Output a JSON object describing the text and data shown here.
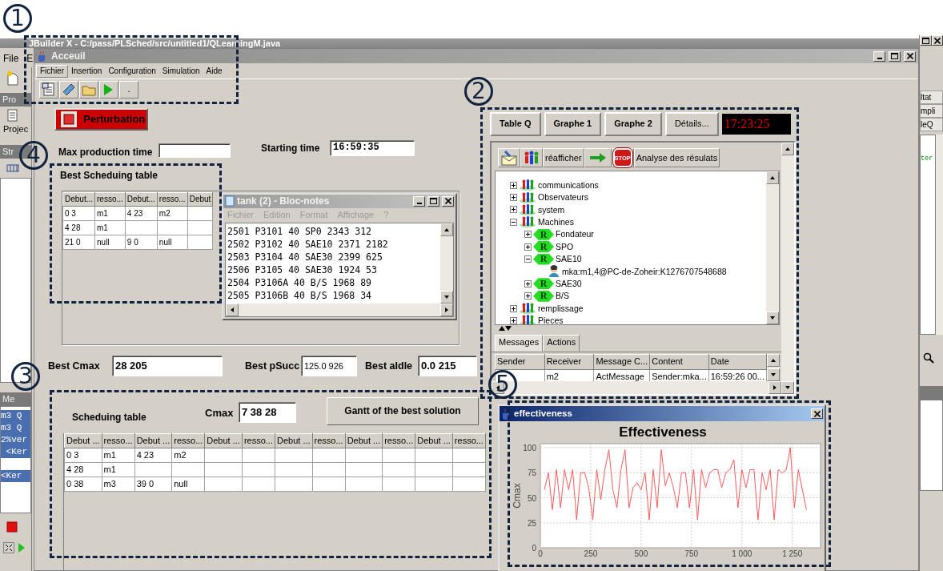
{
  "ide": {
    "title": "JBuilder X - C:/pass/PLSched/src/untitled1/QLearningM.java",
    "menu": [
      "File",
      "E"
    ],
    "left_headers": [
      "Pro",
      "Str",
      "Me"
    ],
    "project_label": "Projec",
    "code_lines": [
      "m3 Q",
      "m3 Q",
      "2%ver",
      " <Ker"
    ],
    "code_lines_lower": [
      "<Ker"
    ],
    "right_tabs": [
      "ltat",
      "mpli",
      "leQ"
    ],
    "right_code": "ter"
  },
  "window": {
    "title": "Acceuil",
    "menu": [
      {
        "label": "Fichier",
        "selected": true
      },
      {
        "label": "Insertion",
        "selected": false
      },
      {
        "label": "Configuration",
        "selected": false
      },
      {
        "label": "Simulation",
        "selected": false
      },
      {
        "label": "Aide",
        "selected": false
      }
    ],
    "toolbar_more": "."
  },
  "perturbation_button": "Perturbation",
  "max_production_time": {
    "label": "Max production time"
  },
  "starting_time": {
    "label": "Starting time",
    "value": "16:59:35"
  },
  "best_table": {
    "title": "Best Scheduing table",
    "columns": [
      "Debut...",
      "resso...",
      "Debut...",
      "resso...",
      "Debut"
    ],
    "rows": [
      [
        "0 3",
        "m1",
        "4 23",
        "m2",
        null
      ],
      [
        "4 28",
        "m1",
        null,
        null,
        null
      ],
      [
        "21 0",
        "null",
        "9 0",
        "null",
        null
      ]
    ]
  },
  "notepad": {
    "title": "tank (2) - Bloc-notes",
    "menu": [
      "Fichier",
      "Edition",
      "Format",
      "Affichage",
      "?"
    ],
    "lines": [
      "2501 P3101 40 SP0 2343 312",
      "2502 P3102 40 SAE10 2371 2182",
      "2503 P3104 40 SAE30 2399 625",
      "2506 P3105 40 SAE30 1924 53",
      "2504 P3106A 40 B/S 1968 89",
      "2505 P3106B 40 B/S 1968 34"
    ]
  },
  "best_results": [
    {
      "label": "Best Cmax",
      "value": "28 205"
    },
    {
      "label": "Best pSucc",
      "value": "125.0 926"
    },
    {
      "label": "Best aIdle",
      "value": "0.0 215"
    }
  ],
  "schedule": {
    "title": "Scheduing table",
    "cmax_label": "Cmax",
    "cmax_value": "7 38 28",
    "gantt_button": "Gantt of the best solution",
    "columns": [
      "Debut ...",
      "resso...",
      "Debut ...",
      "resso...",
      "Debut ...",
      "resso...",
      "Debut ...",
      "resso...",
      "Debut ...",
      "resso...",
      "Debut ...",
      "resso..."
    ],
    "rows": [
      [
        "0 3",
        "m1",
        "4 23",
        "m2",
        null,
        null,
        null,
        null,
        null,
        null,
        null,
        null
      ],
      [
        "4 28",
        "m1",
        null,
        null,
        null,
        null,
        null,
        null,
        null,
        null,
        null,
        null
      ],
      [
        "0 38",
        "m3",
        "39 0",
        "null",
        null,
        null,
        null,
        null,
        null,
        null,
        null,
        null
      ]
    ]
  },
  "agent_panel": {
    "buttons": [
      "Table Q",
      "Graphe 1",
      "Graphe 2"
    ],
    "details_button": "Détails...",
    "clock": "17:23:25",
    "toolbar": {
      "refresh": "réafficher",
      "stop_label": "STOP",
      "analysis": "Analyse des résulats"
    },
    "tree": [
      {
        "label": "communications",
        "kind": "group",
        "expanded": false
      },
      {
        "label": "Observateurs",
        "kind": "group",
        "expanded": false
      },
      {
        "label": "system",
        "kind": "group",
        "expanded": false
      },
      {
        "label": "Machines",
        "kind": "group",
        "expanded": true,
        "children": [
          {
            "label": "Fondateur",
            "kind": "role",
            "badge": "R",
            "expanded": false
          },
          {
            "label": "SPO",
            "kind": "role",
            "badge": "R",
            "expanded": false
          },
          {
            "label": "SAE10",
            "kind": "role",
            "badge": "R",
            "expanded": true,
            "children": [
              {
                "label": "mka:m1,4@PC-de-Zoheir:K1276707548688",
                "kind": "agent"
              }
            ]
          },
          {
            "label": "SAE30",
            "kind": "role",
            "badge": "R",
            "expanded": false
          },
          {
            "label": "B/S",
            "kind": "role",
            "badge": "R",
            "expanded": false
          }
        ]
      },
      {
        "label": "remplissage",
        "kind": "group",
        "expanded": false
      },
      {
        "label": "Pieces",
        "kind": "group",
        "expanded": false
      }
    ],
    "bottom_tabs": [
      {
        "label": "Messages",
        "selected": true
      },
      {
        "label": "Actions",
        "selected": false
      }
    ],
    "messages": {
      "columns": [
        "Sender",
        "Receiver",
        "Message C...",
        "Content",
        "Date"
      ],
      "rows": [
        [
          null,
          "m2",
          "ActMessage",
          "Sender:mka...",
          "16:59:26 00..."
        ]
      ]
    }
  },
  "chart_window": {
    "title": "effectiveness",
    "chart_data": {
      "type": "line",
      "title": "Effectiveness",
      "ylabel": "Cmax",
      "grid": true,
      "xlim": [
        0,
        1390
      ],
      "ylim": [
        0,
        104
      ],
      "yticks": [
        0,
        25,
        50,
        75,
        100
      ],
      "xticks": [
        0,
        250,
        500,
        750,
        {
          "value": 1000,
          "label": "1 000"
        },
        {
          "value": 1250,
          "label": "1 250"
        }
      ],
      "x": [
        20,
        40,
        60,
        80,
        100,
        120,
        140,
        160,
        180,
        200,
        220,
        240,
        260,
        280,
        300,
        320,
        340,
        360,
        380,
        400,
        420,
        440,
        460,
        480,
        500,
        520,
        540,
        560,
        580,
        600,
        620,
        640,
        660,
        680,
        700,
        720,
        740,
        760,
        780,
        800,
        820,
        840,
        860,
        880,
        900,
        920,
        940,
        960,
        980,
        1000,
        1020,
        1040,
        1060,
        1080,
        1100,
        1120,
        1140,
        1160,
        1180,
        1200,
        1220,
        1240,
        1260,
        1280,
        1300,
        1320
      ],
      "series": [
        {
          "color": "#ff5a5a",
          "values": [
            58,
            75,
            38,
            78,
            40,
            78,
            58,
            78,
            28,
            75,
            75,
            60,
            28,
            78,
            48,
            78,
            98,
            58,
            40,
            78,
            98,
            40,
            60,
            65,
            58,
            75,
            28,
            78,
            40,
            98,
            62,
            75,
            60,
            40,
            75,
            75,
            40,
            78,
            28,
            78,
            60,
            75,
            78,
            78,
            60,
            75,
            78,
            88,
            40,
            78,
            60,
            78,
            78,
            28,
            75,
            58,
            78,
            28,
            78,
            75,
            78,
            100,
            40,
            78,
            58,
            38
          ]
        }
      ]
    }
  },
  "annotations": [
    {
      "number": "1"
    },
    {
      "number": "2"
    },
    {
      "number": "3"
    },
    {
      "number": "4"
    },
    {
      "number": "5"
    }
  ]
}
